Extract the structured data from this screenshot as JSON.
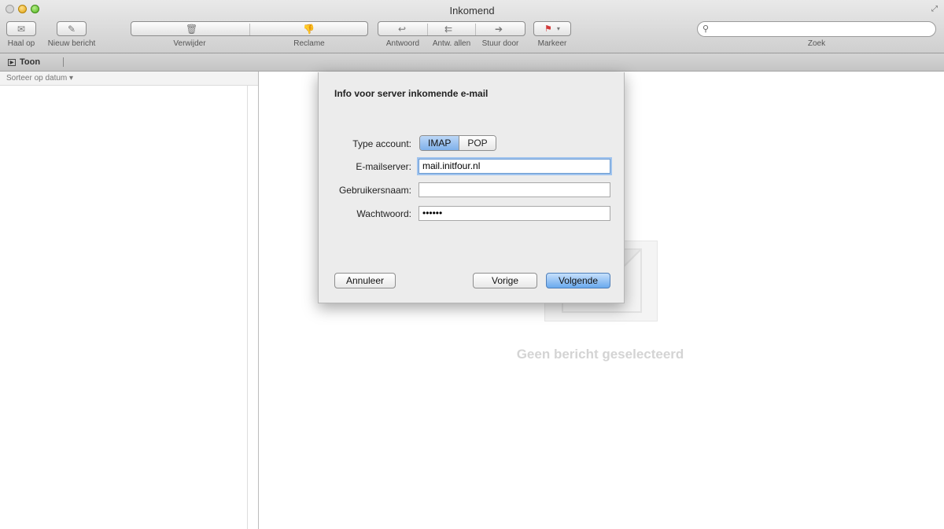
{
  "window": {
    "title": "Inkomend"
  },
  "toolbar": {
    "get_mail_label": "Haal op",
    "new_message_label": "Nieuw bericht",
    "delete_label": "Verwijder",
    "junk_label": "Reclame",
    "reply_label": "Antwoord",
    "reply_all_label": "Antw. allen",
    "forward_label": "Stuur door",
    "flag_label": "Markeer",
    "search_label": "Zoek",
    "search_value": ""
  },
  "subbar": {
    "show_label": "Toon"
  },
  "list": {
    "sort_label": "Sorteer op datum ▾"
  },
  "message_view": {
    "empty_text": "Geen bericht geselecteerd"
  },
  "dialog": {
    "title": "Info voor server inkomende e-mail",
    "account_type_label": "Type account:",
    "account_type_options": [
      "IMAP",
      "POP"
    ],
    "account_type_selected": "IMAP",
    "mail_server_label": "E-mailserver:",
    "mail_server_value": "mail.initfour.nl",
    "username_label": "Gebruikersnaam:",
    "username_value": "",
    "password_label": "Wachtwoord:",
    "password_value": "••••••",
    "cancel_label": "Annuleer",
    "back_label": "Vorige",
    "next_label": "Volgende"
  },
  "colors": {
    "accent_blue": "#6aa9ee",
    "segment_selected": "#7fb0ea",
    "toolbar_gray": "#d8d8d8"
  }
}
